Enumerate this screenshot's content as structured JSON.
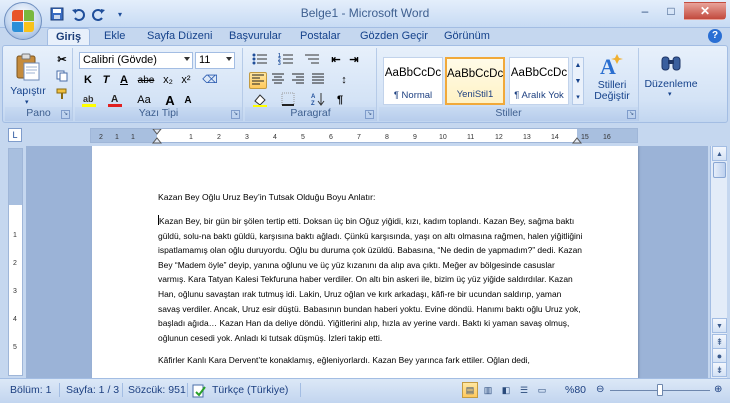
{
  "window": {
    "title": "Belge1 - Microsoft Word"
  },
  "quick_access": {
    "save_icon": "save-icon",
    "undo_icon": "undo-icon",
    "redo_icon": "redo-icon",
    "customize_icon": "customize-qat-icon"
  },
  "window_controls": {
    "minimize": "–",
    "maximize": "□",
    "close": "✕"
  },
  "tabs": [
    {
      "label": "Giriş",
      "active": true
    },
    {
      "label": "Ekle",
      "active": false
    },
    {
      "label": "Sayfa Düzeni",
      "active": false
    },
    {
      "label": "Başvurular",
      "active": false
    },
    {
      "label": "Postalar",
      "active": false
    },
    {
      "label": "Gözden Geçir",
      "active": false
    },
    {
      "label": "Görünüm",
      "active": false
    }
  ],
  "ribbon": {
    "pano": {
      "label": "Pano",
      "paste_label": "Yapıştır"
    },
    "font": {
      "label": "Yazı Tipi",
      "family": "Calibri (Gövde)",
      "size": "11",
      "bold": "K",
      "italic": "T",
      "underline": "A",
      "strike": "abe",
      "subscript": "x₂",
      "superscript": "x²",
      "case": "Aa",
      "grow": "A",
      "shrink": "A"
    },
    "paragraph": {
      "label": "Paragraf",
      "pilcrow": "¶"
    },
    "styles": {
      "label": "Stiller",
      "items": [
        {
          "preview": "AaBbCcDc",
          "name": "¶ Normal",
          "selected": false
        },
        {
          "preview": "AaBbCcDc",
          "name": "YeniStil1",
          "selected": true
        },
        {
          "preview": "AaBbCcDc",
          "name": "¶ Aralık Yok",
          "selected": false
        }
      ],
      "change_styles_label": "Stilleri Değiştir"
    },
    "editing": {
      "label": "Düzenleme"
    }
  },
  "document": {
    "title": "Kazan Bey Oğlu Uruz Bey’in Tutsak Olduğu Boyu Anlatır:",
    "paragraphs": [
      "Kazan Bey, bir gün bir şölen tertip etti. Doksan üç bin Oğuz yiğidi, kızı, kadım toplandı. Kazan Bey, sağma baktı güldü, solu-na baktı güldü, karşısına baktı ağladı. Çünkü karşısında, yaşı on altı olmasına rağmen, halen yiğitliğini ispatlamamış olan oğlu duruyordu. Oğlu bu duruma çok üzüldü. Babasına, “Ne dedin de yapmadım?” dedi. Kazan Bey “Madem öyle” deyip, yanına oğlunu ve üç yüz kızanını da alıp ava çıktı. Meğer av bölgesinde casuslar varmış. Kara Tatyan Kalesi Tekfuruna haber verdiler. On altı bin askeri ile, bizim üç yüz yiğide saldırdılar. Kazan Han, oğlunu savaştan ırak tutmuş idi. Lakin, Uruz oğlan ve kırk arkadaşı, kâfi-re bir ucundan saldırıp, yaman savaş verdiler. Ancak, Uruz esir düştü. Babasının bundan haberi yoktu. Evine döndü. Hanımı baktı oğlu Uruz yok, başladı ağıda… Kazan Han da deliye döndü. Yiğitlerini alıp, hızla av yerine vardı. Baktı ki yaman savaş olmuş, oğlunun cesedi yok. Anladı ki tutsak düşmüş. İzleri takip etti.",
      "Kâfirler Kanlı Kara Dervent’te konaklamış, eğleniyorlardı. Kazan Bey yarınca fark ettiler. Oğlan dedi,"
    ]
  },
  "status": {
    "section": "Bölüm: 1",
    "page": "Sayfa: 1 / 3",
    "words": "Sözcük: 951",
    "language": "Türkçe (Türkiye)",
    "zoom": "%80",
    "zoom_level": 0.5
  }
}
